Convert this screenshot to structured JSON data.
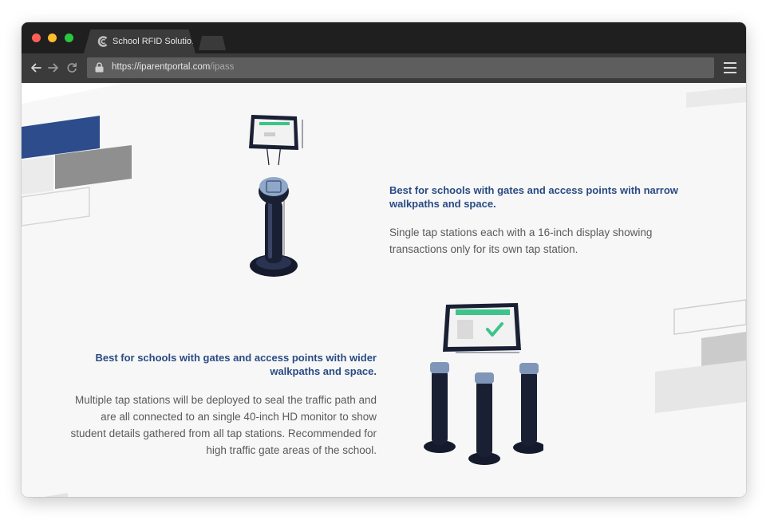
{
  "browser": {
    "tab_title": "School RFID Solutio...",
    "url_host": "https://iparentportal.com",
    "url_path": "/ipass",
    "icons": [
      "back-arrow-icon",
      "forward-arrow-icon",
      "reload-icon",
      "lock-icon",
      "hamburger-menu-icon"
    ]
  },
  "single_station": {
    "heading": "Best for schools with gates and access points with narrow walkpaths and space.",
    "description": "Single tap stations each with a 16-inch display showing transactions only for its own tap station."
  },
  "multi_station": {
    "heading": "Best for schools with gates and access points with wider walkpaths and space.",
    "description": "Multiple tap stations will be deployed to seal the traffic path and are all connected to an single 40-inch HD monitor to show student details gathered from all tap stations. Recommended for high traffic gate areas of the school."
  },
  "colors": {
    "heading": "#2a4b82",
    "body_text": "#5a5a5a",
    "page_bg": "#f7f7f8",
    "accent_green": "#3cc48a",
    "station_dark": "#1a2033"
  }
}
